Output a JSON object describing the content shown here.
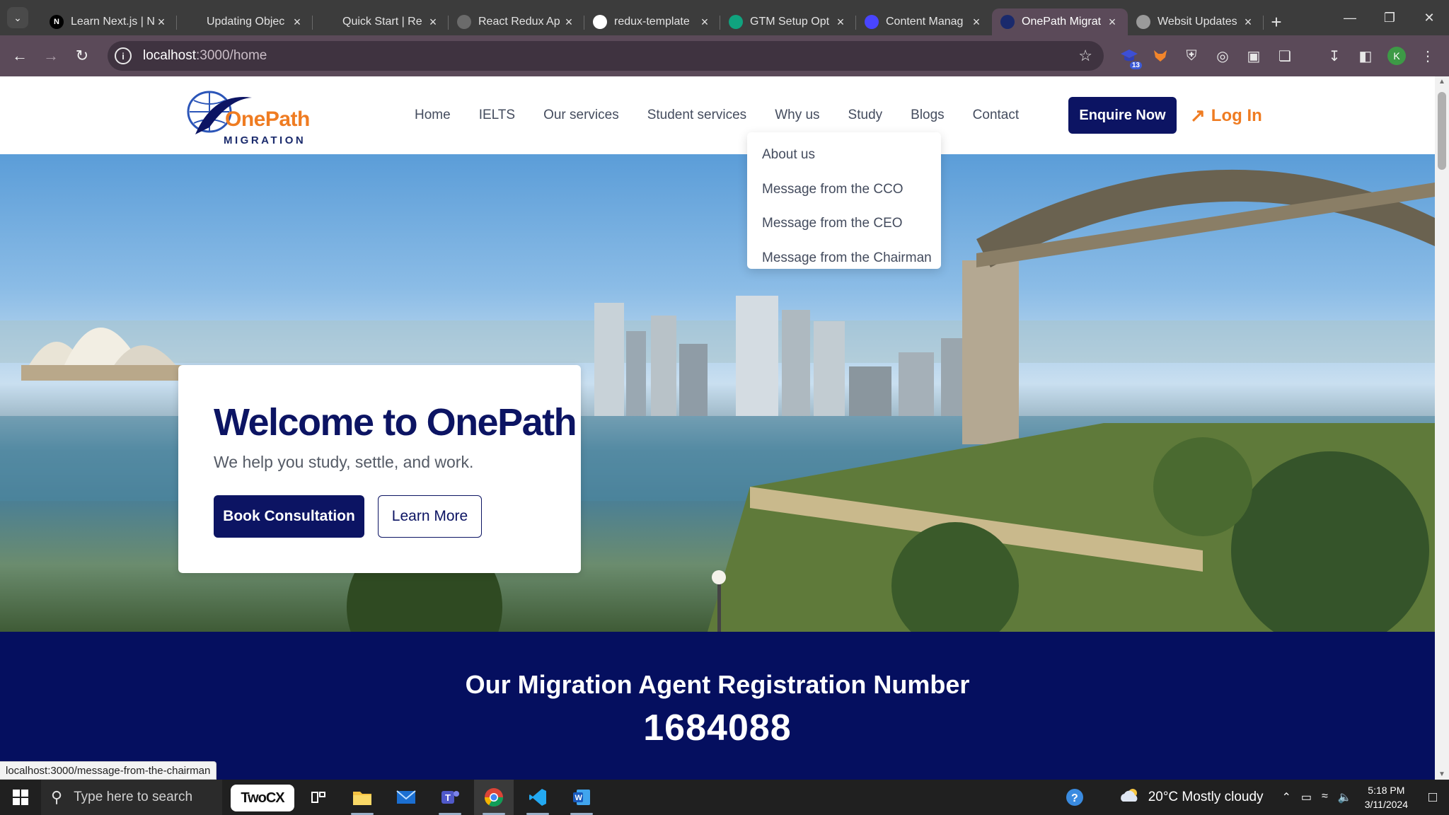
{
  "browser": {
    "tabs": [
      {
        "title": "Learn Next.js | N",
        "favicon": "N",
        "favicon_bg": "#000000"
      },
      {
        "title": "Updating Objec",
        "favicon": "",
        "favicon_bg": "#3c3c3c"
      },
      {
        "title": "Quick Start | Re",
        "favicon": "",
        "favicon_bg": "#3c3c3c"
      },
      {
        "title": "React Redux Ap",
        "favicon": "",
        "favicon_bg": "#6b6b6b"
      },
      {
        "title": "redux-template",
        "favicon": "",
        "favicon_bg": "#ffffff"
      },
      {
        "title": "GTM Setup Opt",
        "favicon": "",
        "favicon_bg": "#10a37f"
      },
      {
        "title": "Content Manag",
        "favicon": "",
        "favicon_bg": "#4945ff"
      },
      {
        "title": "OnePath Migrat",
        "favicon": "",
        "favicon_bg": "#1a2a6c"
      },
      {
        "title": "Websit Updates",
        "favicon": "",
        "favicon_bg": "#9a9a9a"
      }
    ],
    "active_tab_index": 7,
    "url_host": "localhost",
    "url_path": ":3000/home",
    "extension_badge": "13",
    "profile_initial": "K",
    "status_url": "localhost:3000/message-from-the-chairman"
  },
  "site": {
    "logo": {
      "name": "OnePath",
      "sub": "MIGRATION"
    },
    "nav": [
      "Home",
      "IELTS",
      "Our services",
      "Student services",
      "Why us",
      "Study",
      "Blogs",
      "Contact"
    ],
    "enquire_label": "Enquire Now",
    "login_label": "Log In",
    "dropdown": [
      "About us",
      "Message from the CCO",
      "Message from the CEO",
      "Message from the Chairman"
    ],
    "hero": {
      "title": "Welcome to OnePath",
      "subtitle": "We help you study, settle, and work.",
      "primary_cta": "Book Consultation",
      "secondary_cta": "Learn More"
    },
    "registration": {
      "title": "Our Migration Agent Registration Number",
      "number": "1684088"
    }
  },
  "taskbar": {
    "search_placeholder": "Type here to search",
    "pinned_app": "TwoCX",
    "weather": "20°C  Mostly cloudy",
    "time": "5:18 PM",
    "date": "3/11/2024"
  },
  "colors": {
    "brand_navy": "#0c1463",
    "brand_orange": "#ef7c22",
    "chrome_tab_bar": "#3c3c3c",
    "chrome_toolbar": "#5b4a59"
  }
}
